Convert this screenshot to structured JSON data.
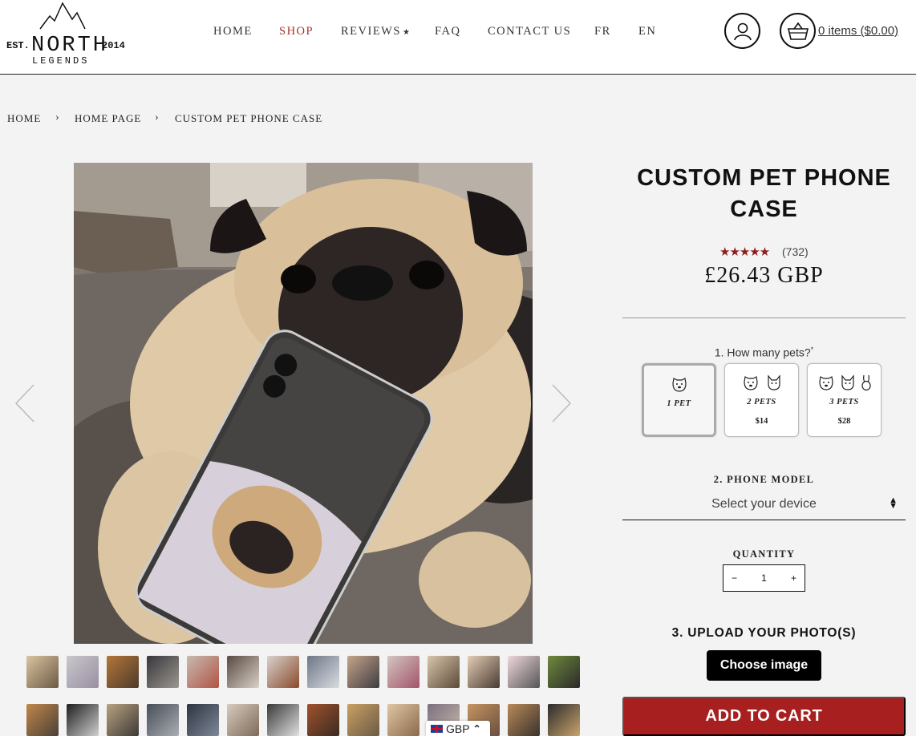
{
  "brand": {
    "est": "EST.",
    "north": "NORTH",
    "year": "2014",
    "legends": "LEGENDS"
  },
  "nav": {
    "home": "HOME",
    "shop": "SHOP",
    "reviews": "REVIEWS",
    "reviews_star": "★",
    "faq": "FAQ",
    "contact": "CONTACT US",
    "fr": "FR",
    "en": "EN"
  },
  "header": {
    "cart_text": "0 items ($0.00)",
    "account_icon": "user-icon",
    "cart_icon": "basket-icon"
  },
  "breadcrumb": {
    "home": "HOME",
    "sep1": "›",
    "page": "HOME PAGE",
    "sep2": "›",
    "current": "CUSTOM PET PHONE CASE"
  },
  "product": {
    "title": "CUSTOM PET PHONE CASE",
    "stars": "★★★★★",
    "rating_value": 5,
    "review_count": "(732)",
    "price": "£26.43 GBP"
  },
  "options": {
    "question1": "1. How many pets?",
    "required_mark": "*",
    "pets": [
      {
        "label": "1 PET",
        "add": ""
      },
      {
        "label": "2 PETS",
        "add": "$14"
      },
      {
        "label": "3 PETS",
        "add": "$28"
      }
    ]
  },
  "phone_model": {
    "label": "2. PHONE MODEL",
    "placeholder": "Select your device"
  },
  "quantity": {
    "label": "QUANTITY",
    "minus": "−",
    "value": "1",
    "plus": "+"
  },
  "upload": {
    "label": "3. UPLOAD YOUR PHOTO(S)",
    "button": "Choose image"
  },
  "add_to_cart": "ADD TO CART",
  "currency": {
    "code": "GBP",
    "caret": "⌃"
  },
  "colors": {
    "accent": "#a1362c",
    "cta": "#a81f1f",
    "stars": "#8b1d1d"
  }
}
